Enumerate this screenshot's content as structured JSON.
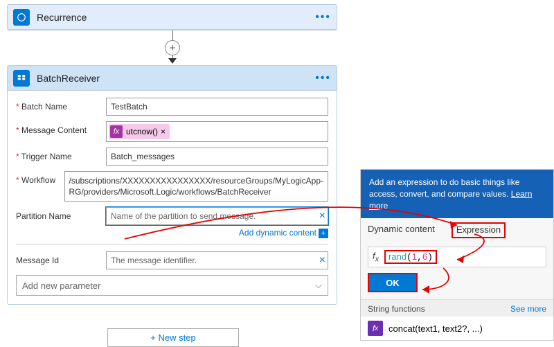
{
  "recurrence": {
    "title": "Recurrence"
  },
  "batch": {
    "title": "BatchReceiver",
    "fields": {
      "batch_name_label": "Batch Name",
      "batch_name_value": "TestBatch",
      "message_content_label": "Message Content",
      "message_content_tag": "utcnow()",
      "trigger_name_label": "Trigger Name",
      "trigger_name_value": "Batch_messages",
      "workflow_label": "Workflow",
      "workflow_value": "/subscriptions/XXXXXXXXXXXXXXXX/resourceGroups/MyLogicApp-RG/providers/Microsoft.Logic/workflows/BatchReceiver",
      "partition_label": "Partition Name",
      "partition_placeholder": "Name of the partition to send message.",
      "message_id_label": "Message Id",
      "message_id_placeholder": "The message identifier.",
      "add_param": "Add new parameter",
      "add_dynamic": "Add dynamic content"
    }
  },
  "new_step": "+ New step",
  "panel": {
    "head": "Add an expression to do basic things like access, convert, and compare values.",
    "learn_more": "Learn more",
    "tab_dynamic": "Dynamic content",
    "tab_expression": "Expression",
    "expr_fn": "rand",
    "expr_a": "1",
    "expr_b": "6",
    "ok": "OK",
    "section": "String functions",
    "see_more": "See more",
    "fn1": "concat(text1, text2?, ...)"
  }
}
